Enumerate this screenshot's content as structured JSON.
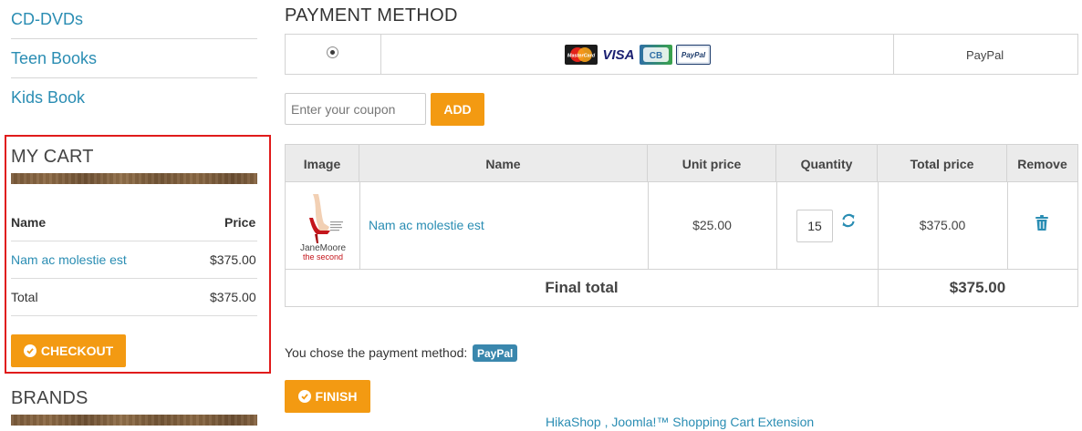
{
  "sidebar": {
    "categories": [
      "CD-DVDs",
      "Teen Books",
      "Kids Book"
    ],
    "cart": {
      "title": "MY CART",
      "col_name": "Name",
      "col_price": "Price",
      "item_name": "Nam ac molestie est",
      "item_price": "$375.00",
      "total_label": "Total",
      "total_value": "$375.00",
      "checkout_label": "CHECKOUT"
    },
    "brands_title": "BRANDS"
  },
  "main": {
    "title": "PAYMENT METHOD",
    "payment": {
      "selected": true,
      "logos": [
        "MasterCard",
        "VISA",
        "CB",
        "PayPal"
      ],
      "name": "PayPal"
    },
    "coupon": {
      "placeholder": "Enter your coupon",
      "value": "",
      "add_label": "ADD"
    },
    "table": {
      "headers": [
        "Image",
        "Name",
        "Unit price",
        "Quantity",
        "Total price",
        "Remove"
      ],
      "row": {
        "name": "Nam ac molestie est",
        "unit_price": "$25.00",
        "quantity": "15",
        "total_price": "$375.00",
        "cover_author": "JaneMoore",
        "cover_title": "the second"
      },
      "final_label": "Final total",
      "final_value": "$375.00"
    },
    "payment_chosen_text": "You chose the payment method:",
    "payment_chosen_badge": "PayPal",
    "finish_label": "FINISH",
    "footer_link": "HikaShop , Joomla!™ Shopping Cart Extension"
  },
  "colors": {
    "accent": "#f39a12",
    "link": "#2a8db3",
    "highlight_border": "#e01b1b",
    "badge": "#3a87ad"
  }
}
